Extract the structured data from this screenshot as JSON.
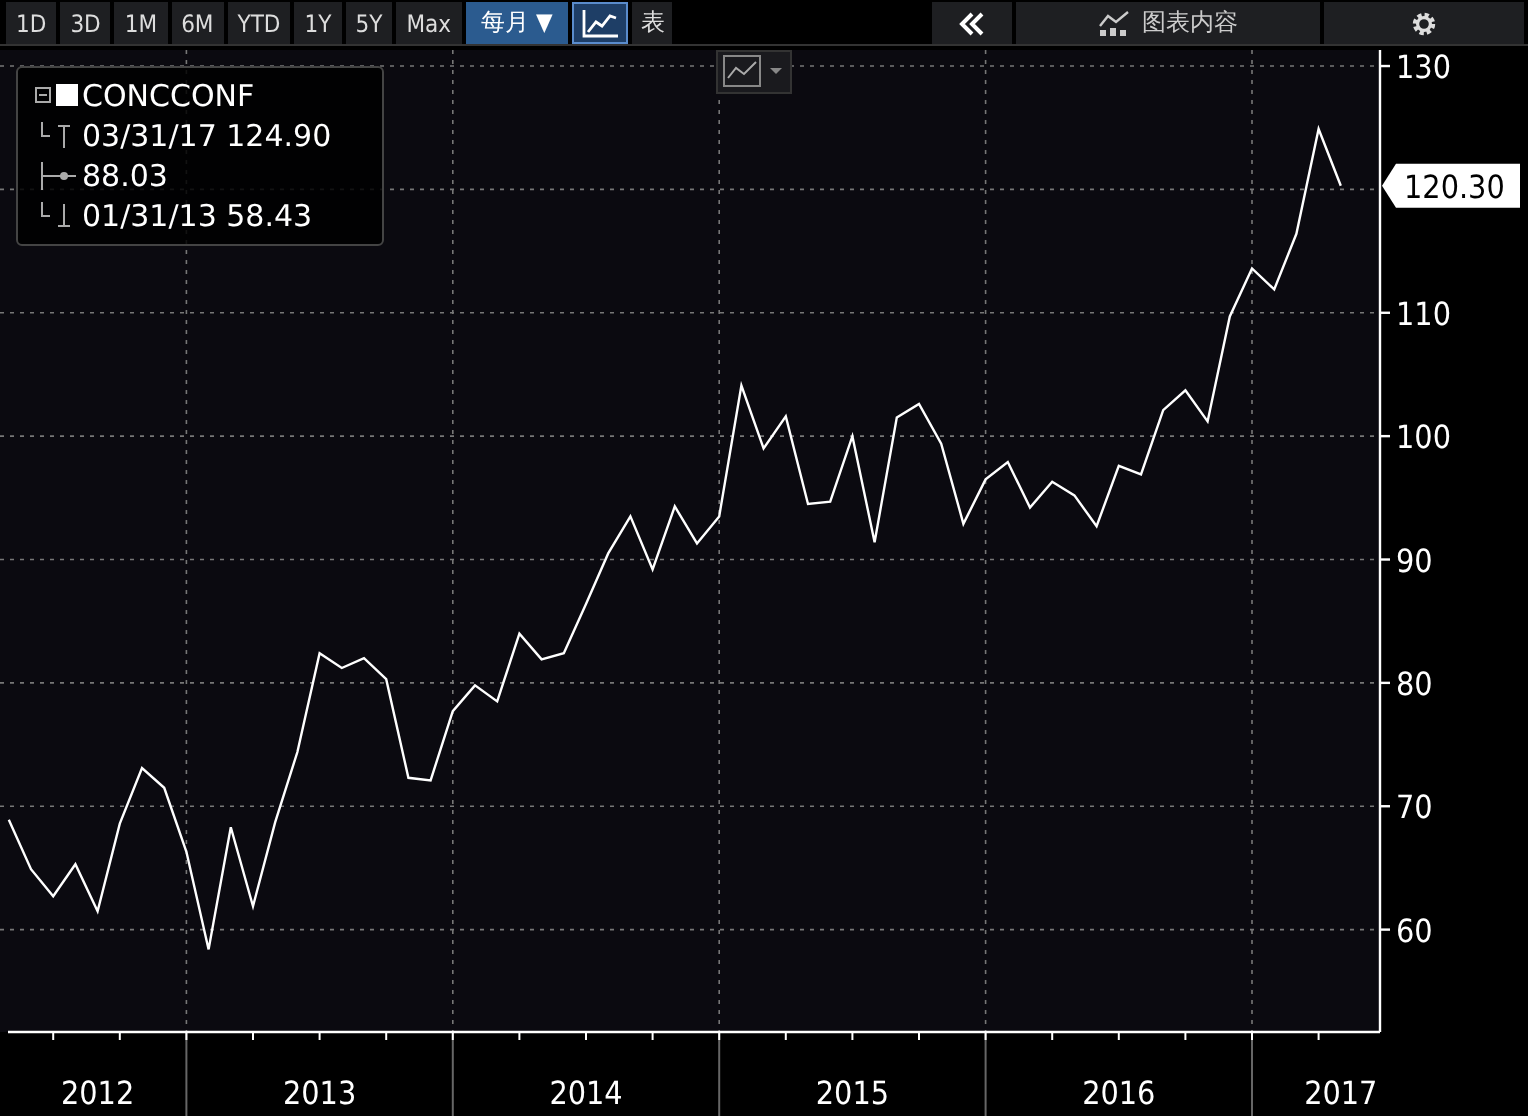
{
  "toolbar": {
    "periods": [
      {
        "label": "1D",
        "selected": false
      },
      {
        "label": "3D",
        "selected": false
      },
      {
        "label": "1M",
        "selected": false
      },
      {
        "label": "6M",
        "selected": false
      },
      {
        "label": "YTD",
        "selected": false
      },
      {
        "label": "1Y",
        "selected": false
      },
      {
        "label": "5Y",
        "selected": false
      },
      {
        "label": "Max",
        "selected": false
      }
    ],
    "frequency": {
      "label": "每月 ▼",
      "selected": true
    },
    "view_buttons": [
      {
        "kind": "chart",
        "selected": true
      },
      {
        "kind": "table",
        "label": "表",
        "selected": false
      }
    ],
    "chart_contents_label": "图表内容"
  },
  "legend": {
    "high": "03/31/17 124.90",
    "average": "88.03",
    "low": "01/31/13 58.43"
  },
  "last_value": "120.30",
  "chart_data": {
    "type": "line",
    "grid": true,
    "categories": [
      null,
      null,
      null,
      null,
      "2012",
      null,
      null,
      null,
      null,
      null,
      null,
      null,
      null,
      null,
      "2013",
      null,
      null,
      null,
      null,
      null,
      null,
      null,
      null,
      null,
      null,
      null,
      "2014",
      null,
      null,
      null,
      null,
      null,
      null,
      null,
      null,
      null,
      null,
      null,
      "2015",
      null,
      null,
      null,
      null,
      null,
      null,
      null,
      null,
      null,
      null,
      null,
      "2016",
      null,
      null,
      null,
      null,
      null,
      null,
      null,
      null,
      null,
      "2017"
    ],
    "series": [
      {
        "name": "CONCCONF",
        "color": "#ffffff",
        "values": [
          68.9,
          64.9,
          62.7,
          65.3,
          61.5,
          68.6,
          73.1,
          71.5,
          66.3,
          58.4,
          68.3,
          61.9,
          68.7,
          74.4,
          82.4,
          81.2,
          82.0,
          80.3,
          72.3,
          72.1,
          77.7,
          79.8,
          78.5,
          84.0,
          81.9,
          82.4,
          86.4,
          90.5,
          93.5,
          89.2,
          94.3,
          91.3,
          93.5,
          104.1,
          99.0,
          101.6,
          94.5,
          94.7,
          100.0,
          91.4,
          101.5,
          102.6,
          99.4,
          92.9,
          96.5,
          97.9,
          94.2,
          96.3,
          95.2,
          92.7,
          97.6,
          96.9,
          102.1,
          103.7,
          101.2,
          109.7,
          113.6,
          111.9,
          116.4,
          124.9,
          120.3
        ]
      }
    ],
    "ylim": [
      51.7,
      131.3
    ],
    "yticks": [
      60,
      70,
      80,
      90,
      100,
      110,
      130
    ]
  }
}
